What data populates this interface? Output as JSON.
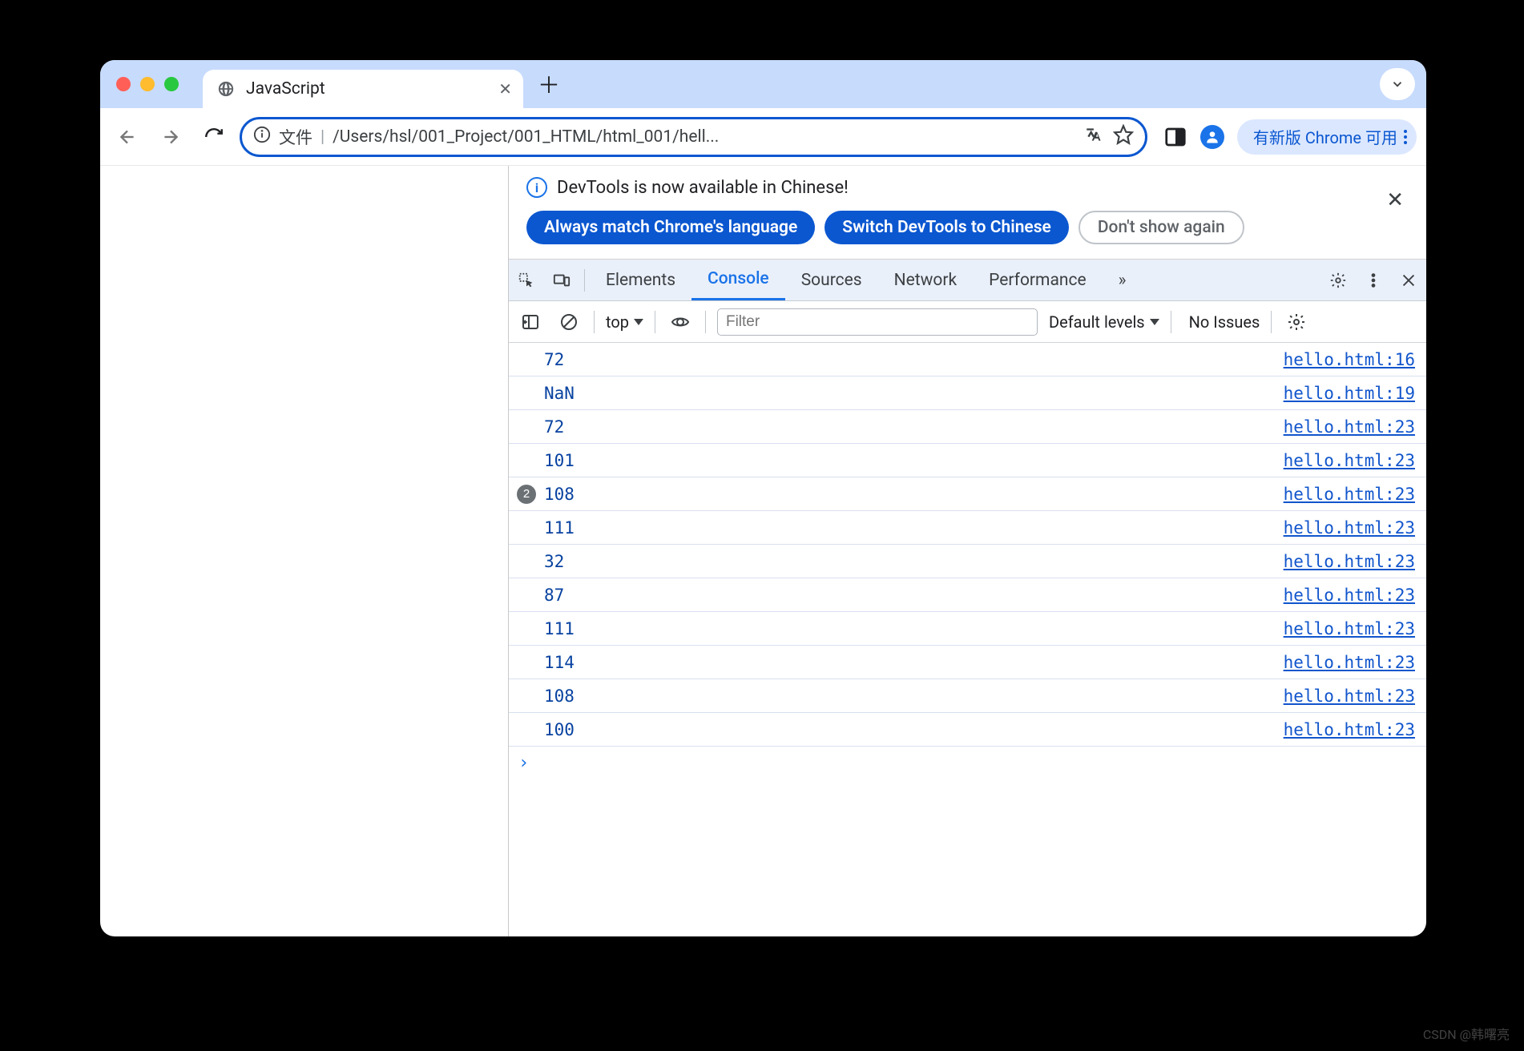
{
  "tab": {
    "title": "JavaScript"
  },
  "omnibox": {
    "file_label": "文件",
    "path": "/Users/hsl/001_Project/001_HTML/html_001/hell..."
  },
  "update_chip": "有新版 Chrome 可用",
  "banner": {
    "message": "DevTools is now available in Chinese!",
    "always": "Always match Chrome's language",
    "switch": "Switch DevTools to Chinese",
    "dont": "Don't show again"
  },
  "devtool_tabs": [
    "Elements",
    "Console",
    "Sources",
    "Network",
    "Performance"
  ],
  "devtool_active": 1,
  "console_bar": {
    "context": "top",
    "filter_placeholder": "Filter",
    "levels": "Default levels",
    "issues": "No Issues"
  },
  "console_rows": [
    {
      "value": "72",
      "source": "hello.html:16",
      "badge": null
    },
    {
      "value": "NaN",
      "source": "hello.html:19",
      "badge": null
    },
    {
      "value": "72",
      "source": "hello.html:23",
      "badge": null
    },
    {
      "value": "101",
      "source": "hello.html:23",
      "badge": null
    },
    {
      "value": "108",
      "source": "hello.html:23",
      "badge": "2"
    },
    {
      "value": "111",
      "source": "hello.html:23",
      "badge": null
    },
    {
      "value": "32",
      "source": "hello.html:23",
      "badge": null
    },
    {
      "value": "87",
      "source": "hello.html:23",
      "badge": null
    },
    {
      "value": "111",
      "source": "hello.html:23",
      "badge": null
    },
    {
      "value": "114",
      "source": "hello.html:23",
      "badge": null
    },
    {
      "value": "108",
      "source": "hello.html:23",
      "badge": null
    },
    {
      "value": "100",
      "source": "hello.html:23",
      "badge": null
    }
  ],
  "watermark": "CSDN @韩曙亮"
}
